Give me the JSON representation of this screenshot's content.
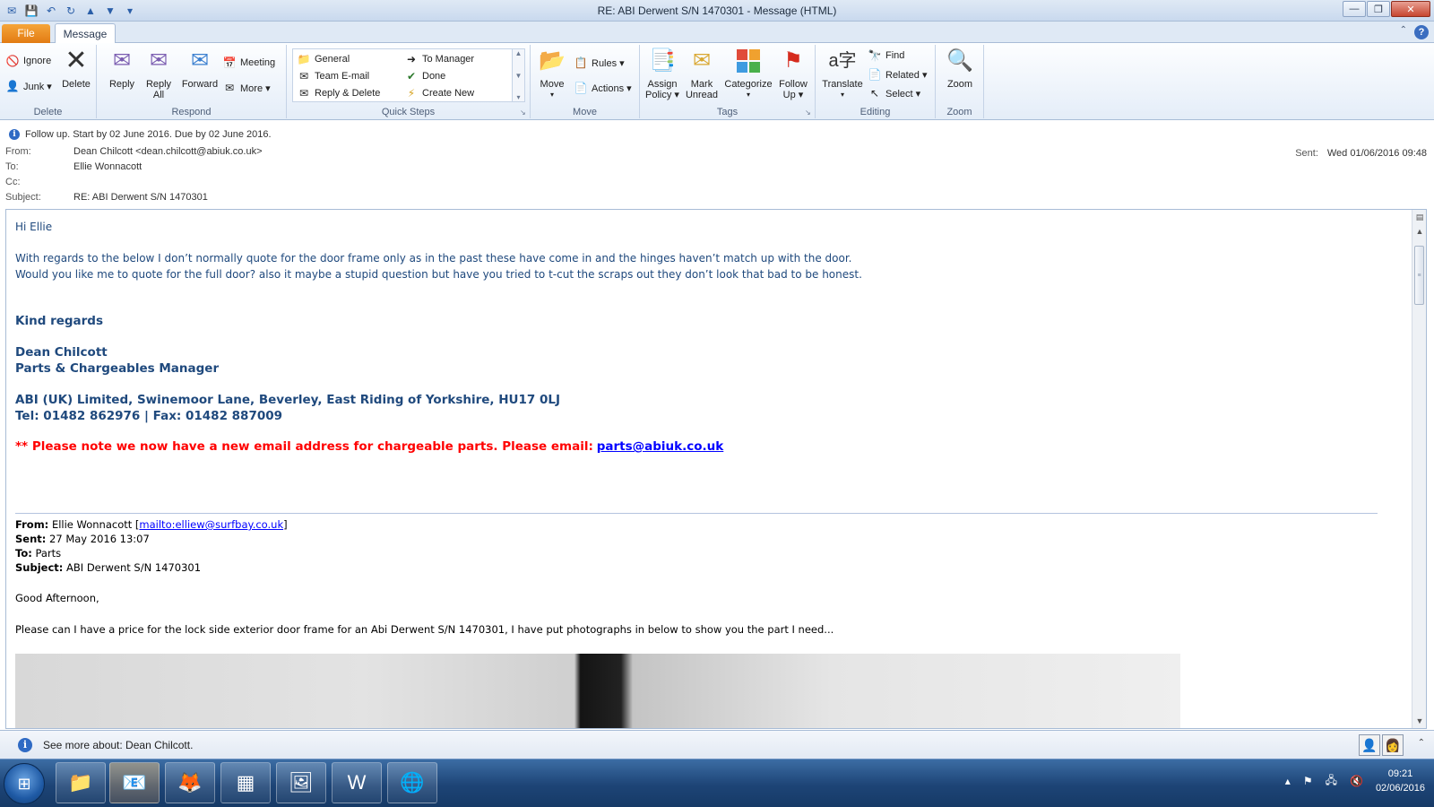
{
  "window": {
    "title": "RE: ABI Derwent S/N 1470301  -  Message (HTML)",
    "minimize": "—",
    "restore": "❐",
    "close": "✕"
  },
  "tabs": {
    "file": "File",
    "message": "Message",
    "help": "?"
  },
  "ribbon": {
    "delete_group": {
      "label": "Delete",
      "ignore": "Ignore",
      "junk": "Junk ▾",
      "delete": "Delete"
    },
    "respond_group": {
      "label": "Respond",
      "reply": "Reply",
      "reply_all_1": "Reply",
      "reply_all_2": "All",
      "forward": "Forward",
      "meeting": "Meeting",
      "more": "More ▾"
    },
    "quicksteps_group": {
      "label": "Quick Steps",
      "items": [
        "General",
        "Team E-mail",
        "Reply & Delete",
        "To Manager",
        "Done",
        "Create New"
      ]
    },
    "move_group": {
      "label": "Move",
      "move": "Move",
      "rules": "Rules ▾",
      "actions": "Actions ▾"
    },
    "tags_group": {
      "label": "Tags",
      "assign_1": "Assign",
      "assign_2": "Policy ▾",
      "mark_1": "Mark",
      "mark_2": "Unread",
      "categorize": "Categorize",
      "follow_1": "Follow",
      "follow_2": "Up ▾"
    },
    "editing_group": {
      "label": "Editing",
      "translate": "Translate",
      "find": "Find",
      "related": "Related ▾",
      "select": "Select ▾"
    },
    "zoom_group": {
      "label": "Zoom",
      "zoom": "Zoom"
    }
  },
  "header": {
    "followup": "Follow up.  Start by 02 June 2016.  Due by 02 June 2016.",
    "from_label": "From:",
    "from_value": "Dean Chilcott <dean.chilcott@abiuk.co.uk>",
    "to_label": "To:",
    "to_value": "Ellie Wonnacott",
    "cc_label": "Cc:",
    "cc_value": "",
    "subject_label": "Subject:",
    "subject_value": "RE: ABI Derwent S/N 1470301",
    "sent_label": "Sent:",
    "sent_value": "Wed 01/06/2016 09:48"
  },
  "body": {
    "greeting": "Hi Ellie",
    "line1": "With regards to the below I don’t normally quote for the door frame only as in the past these have come in and the hinges haven’t match up with the door.",
    "line2": "Would you like me to quote for the full door? also it maybe a stupid question but have you tried to t-cut the scraps out they don’t look that bad to be honest.",
    "regards": "Kind regards",
    "sig_name": "Dean Chilcott",
    "sig_title": "Parts & Chargeables Manager",
    "sig_address": "ABI (UK) Limited, Swinemoor Lane, Beverley, East Riding of Yorkshire, HU17 0LJ",
    "sig_phone": "Tel: 01482 862976  | Fax: 01482 887009",
    "notice": "** Please note we now have a new email address for chargeable parts.  Please email:",
    "notice_link": "parts@abiuk.co.uk"
  },
  "original": {
    "from_label": "From:",
    "from_name": "Ellie Wonnacott",
    "from_link": "mailto:elliew@surfbay.co.uk",
    "sent_label": "Sent:",
    "sent_value": "27 May 2016 13:07",
    "to_label": "To:",
    "to_value": "Parts",
    "subject_label": "Subject:",
    "subject_value": "ABI Derwent S/N 1470301",
    "greeting": "Good Afternoon,",
    "text": "Please can I have a price for the lock side exterior door frame for an Abi Derwent S/N 1470301, I have put photographs in below to show you the part I need..."
  },
  "people_pane": {
    "text": "See more about: Dean Chilcott."
  },
  "taskbar": {
    "time": "09:21",
    "date": "02/06/2016"
  }
}
